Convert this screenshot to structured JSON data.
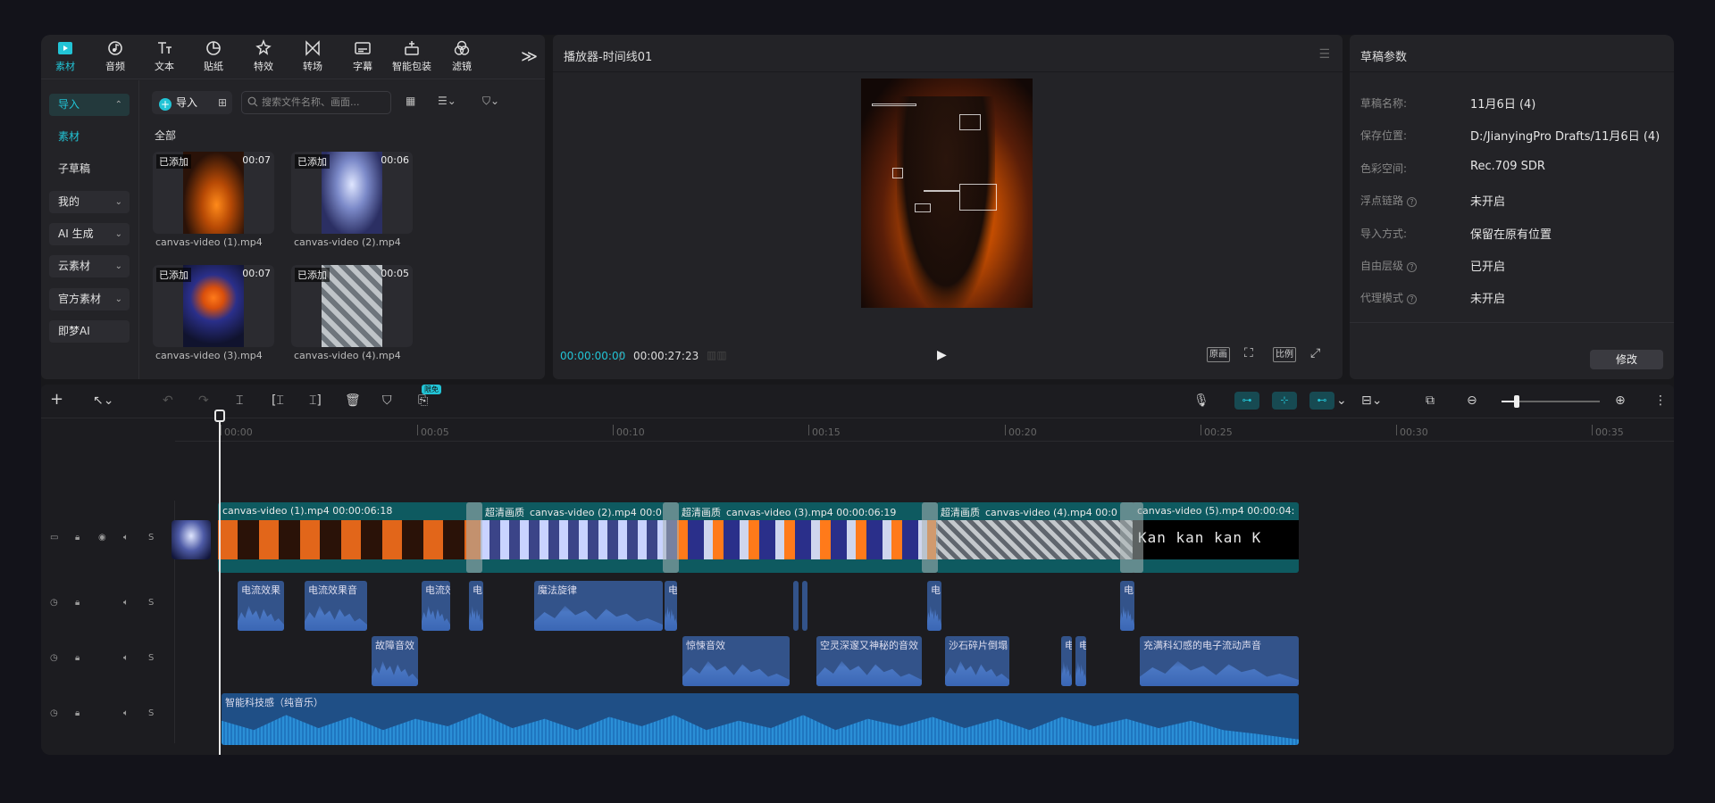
{
  "toolbar": {
    "tabs": [
      {
        "label": "素材",
        "icon": "media-icon"
      },
      {
        "label": "音频",
        "icon": "audio-icon"
      },
      {
        "label": "文本",
        "icon": "text-icon"
      },
      {
        "label": "贴纸",
        "icon": "sticker-icon"
      },
      {
        "label": "特效",
        "icon": "effects-icon"
      },
      {
        "label": "转场",
        "icon": "transition-icon"
      },
      {
        "label": "字幕",
        "icon": "subtitle-icon"
      },
      {
        "label": "智能包装",
        "icon": "smart-package-icon"
      },
      {
        "label": "滤镜",
        "icon": "filter-icon"
      }
    ],
    "more": "≫"
  },
  "sidebar": {
    "items": [
      {
        "label": "导入"
      },
      {
        "label": "素材"
      },
      {
        "label": "子草稿"
      },
      {
        "label": "我的"
      },
      {
        "label": "AI 生成"
      },
      {
        "label": "云素材"
      },
      {
        "label": "官方素材"
      },
      {
        "label": "即梦AI"
      }
    ]
  },
  "library": {
    "import_label": "导入",
    "search_placeholder": "搜索文件名称、画面...",
    "section": "全部",
    "items": [
      {
        "name": "canvas-video (1).mp4",
        "badge": "已添加",
        "duration": "00:07"
      },
      {
        "name": "canvas-video (2).mp4",
        "badge": "已添加",
        "duration": "00:06"
      },
      {
        "name": "canvas-video (3).mp4",
        "badge": "已添加",
        "duration": "00:07"
      },
      {
        "name": "canvas-video (4).mp4",
        "badge": "已添加",
        "duration": "00:05"
      }
    ]
  },
  "player": {
    "title": "播放器-时间线01",
    "current": "00:00:00:00",
    "sep": "/",
    "total": "00:00:27:23",
    "btn_original": "原画",
    "btn_ratio": "比例"
  },
  "params": {
    "title": "草稿参数",
    "rows": [
      {
        "label": "草稿名称:",
        "value": "11月6日 (4)"
      },
      {
        "label": "保存位置:",
        "value": "D:/JianyingPro Drafts/11月6日 (4)"
      },
      {
        "label": "色彩空间:",
        "value": "Rec.709 SDR"
      },
      {
        "label": "浮点链路",
        "value": "未开启"
      },
      {
        "label": "导入方式:",
        "value": "保留在原有位置"
      },
      {
        "label": "自由层级",
        "value": "已开启"
      },
      {
        "label": "代理模式",
        "value": "未开启"
      }
    ],
    "modify": "修改"
  },
  "timeline": {
    "badge": "限免",
    "ruler": [
      "00:00",
      "00:05",
      "00:10",
      "00:15",
      "00:20",
      "00:25",
      "00:30",
      "00:35"
    ],
    "video_clips": [
      {
        "label": "canvas-video (1).mp4   00:00:06:18",
        "tag": ""
      },
      {
        "label": "canvas-video (2).mp4   00:0",
        "tag": "超清画质"
      },
      {
        "label": "canvas-video (3).mp4   00:00:06:19",
        "tag": "超清画质"
      },
      {
        "label": "canvas-video (4).mp4   00:0",
        "tag": "超清画质"
      },
      {
        "label": "canvas-video (5).mp4   00:00:04:",
        "tag": ""
      }
    ],
    "audio1": [
      "电流效果",
      "电流效果音",
      "电流效",
      "电",
      "魔法旋律",
      "电",
      "电",
      "电"
    ],
    "audio2": [
      "故障音效",
      "惊悚音效",
      "空灵深邃又神秘的音效",
      "沙石碎片倒塌",
      "电",
      "电",
      "充满科幻感的电子流动声音"
    ],
    "music": "智能科技感（纯音乐）",
    "text_overlay": "Kan kan kan K"
  },
  "colors": {
    "accent": "#22c4d6",
    "video_track": "#0e5a60",
    "audio_clip": "#33538a",
    "music_clip": "#1f4f86"
  }
}
